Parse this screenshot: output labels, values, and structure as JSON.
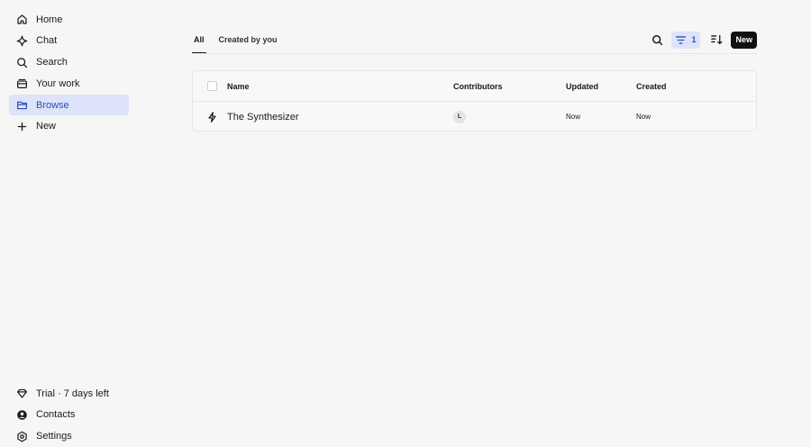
{
  "sidebar": {
    "items": [
      {
        "label": "Home",
        "icon": "home-icon"
      },
      {
        "label": "Chat",
        "icon": "sparkle-icon"
      },
      {
        "label": "Search",
        "icon": "search-icon"
      },
      {
        "label": "Your work",
        "icon": "stack-icon"
      },
      {
        "label": "Browse",
        "icon": "folder-icon",
        "active": true
      },
      {
        "label": "New",
        "icon": "plus-icon"
      }
    ],
    "bottom_items": [
      {
        "label": "Trial · 7 days left",
        "icon": "gem-icon"
      },
      {
        "label": "Contacts",
        "icon": "contact-icon"
      },
      {
        "label": "Settings",
        "icon": "gear-icon"
      }
    ]
  },
  "tabs": [
    {
      "label": "All",
      "active": true
    },
    {
      "label": "Created by you",
      "active": false
    }
  ],
  "toolbar": {
    "filter_count": "1",
    "new_label": "New"
  },
  "table": {
    "columns": [
      "Name",
      "Contributors",
      "Updated",
      "Created"
    ],
    "rows": [
      {
        "name": "The Synthesizer",
        "contributor_initial": "L",
        "updated": "Now",
        "created": "Now"
      }
    ]
  },
  "colors": {
    "accent": "#2a4fb8",
    "accent_bg": "#dde3f8",
    "background": "#f6f6f6"
  }
}
